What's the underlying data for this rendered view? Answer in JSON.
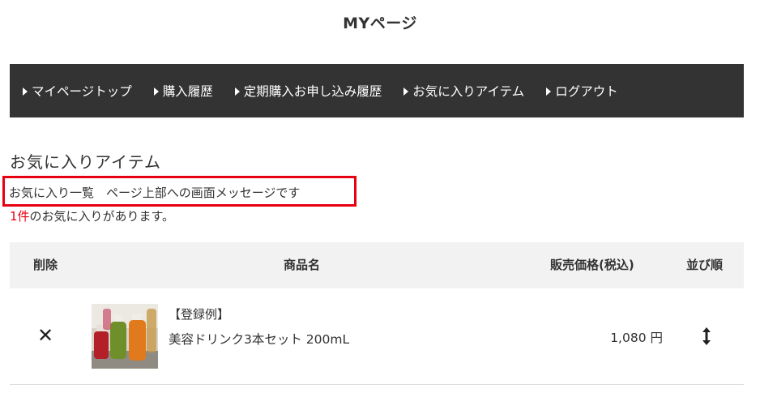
{
  "page": {
    "title": "MYページ"
  },
  "nav": {
    "items": [
      {
        "label": "マイページトップ"
      },
      {
        "label": "購入履歴"
      },
      {
        "label": "定期購入お申し込み履歴"
      },
      {
        "label": "お気に入りアイテム"
      },
      {
        "label": "ログアウト"
      }
    ]
  },
  "favorites": {
    "heading": "お気に入りアイテム",
    "message": "お気に入り一覧　ページ上部への画面メッセージです",
    "count": "1件",
    "count_suffix": "のお気に入りがあります。",
    "table": {
      "headers": {
        "delete": "削除",
        "name": "商品名",
        "price": "販売価格(税込)",
        "order": "並び順"
      },
      "rows": [
        {
          "delete_icon": "close-icon",
          "tag": "【登録例】",
          "name": "美容ドリンク3本セット 200mL",
          "price": "1,080 円",
          "sort_icon": "vertical-arrows-icon"
        }
      ]
    }
  },
  "colors": {
    "nav_bg": "#333333",
    "accent_red": "#e60012",
    "table_head_bg": "#f2f2f2"
  }
}
